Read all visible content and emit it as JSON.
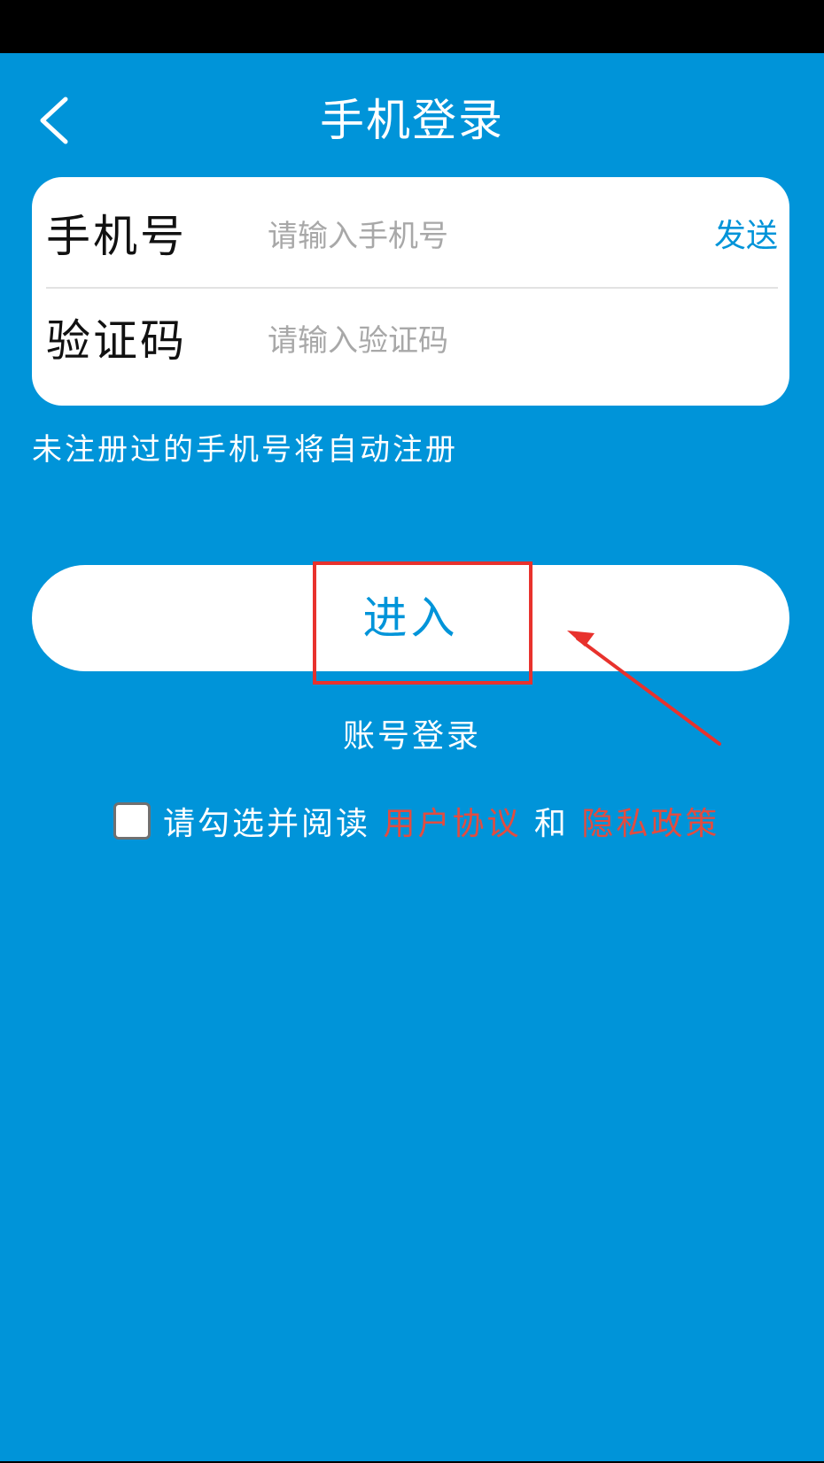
{
  "header": {
    "title": "手机登录",
    "back_icon": "chevron-left-icon"
  },
  "form": {
    "phone_label": "手机号",
    "phone_placeholder": "请输入手机号",
    "phone_value": "",
    "send_label": "发送",
    "code_label": "验证码",
    "code_placeholder": "请输入验证码",
    "code_value": ""
  },
  "hint": "未注册过的手机号将自动注册",
  "enter_label": "进入",
  "account_login_label": "账号登录",
  "agreement": {
    "checked": false,
    "prefix": "请勾选并阅读 ",
    "user_agreement": "用户协议",
    "connector": " 和 ",
    "privacy_policy": "隐私政策"
  },
  "colors": {
    "background": "#0094d9",
    "accent": "#0094d9",
    "link": "#e24c40",
    "annotation": "#e8322d"
  }
}
